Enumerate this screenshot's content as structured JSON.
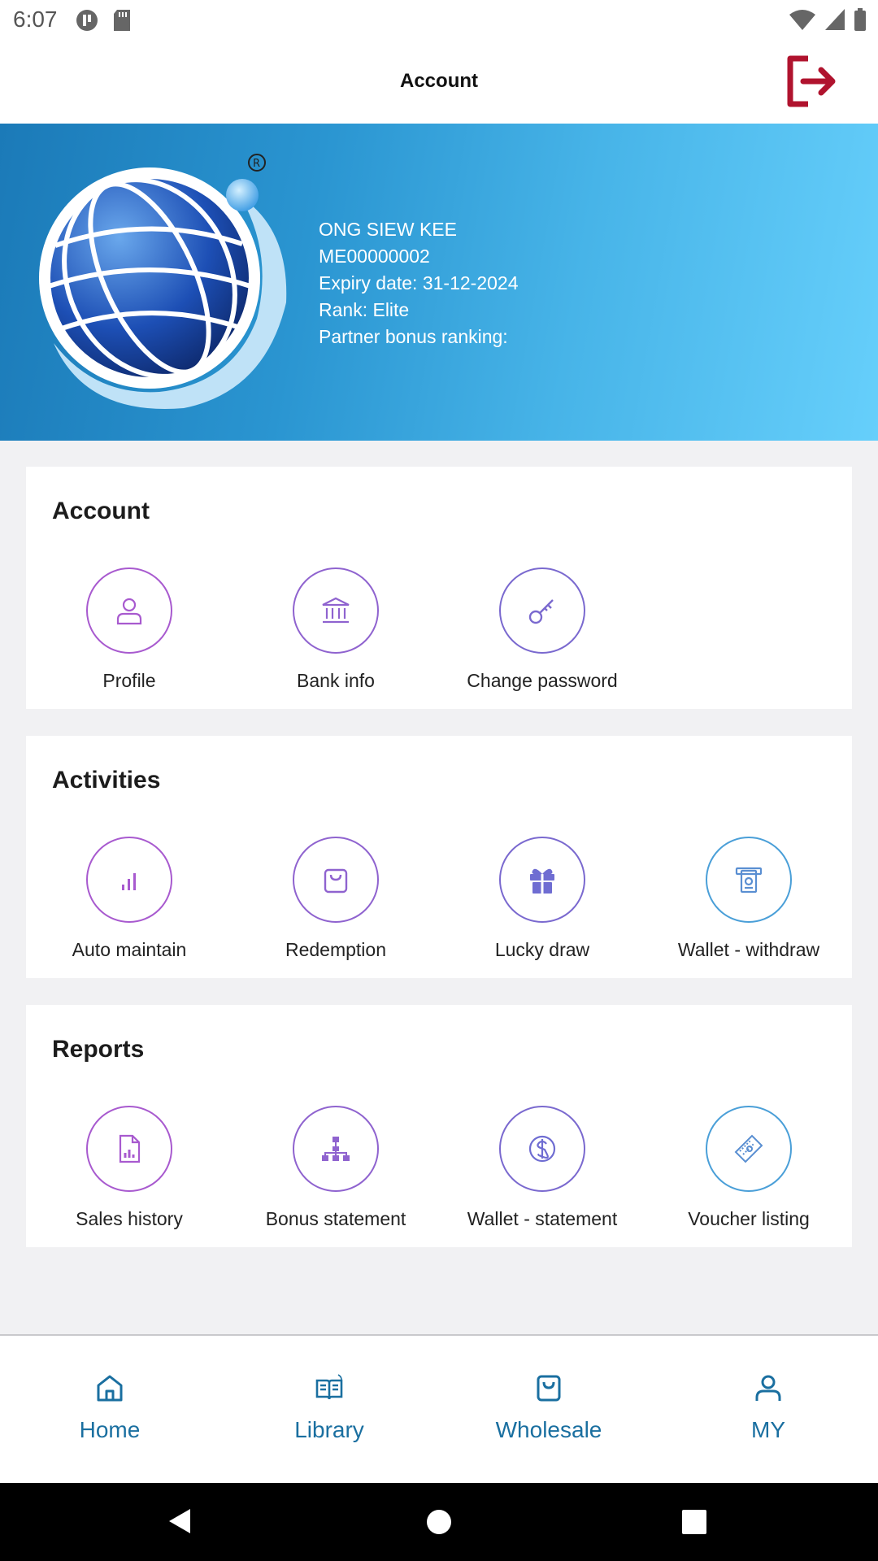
{
  "status_bar": {
    "time": "6:07"
  },
  "header": {
    "title": "Account"
  },
  "member": {
    "name": "ONG SIEW KEE",
    "id": "ME00000002",
    "expiry": "Expiry date: 31-12-2024",
    "rank": "Rank: Elite",
    "partner_bonus": "Partner bonus ranking:"
  },
  "sections": {
    "account": {
      "title": "Account",
      "items": [
        {
          "label": "Profile",
          "icon": "person-icon"
        },
        {
          "label": "Bank info",
          "icon": "bank-icon"
        },
        {
          "label": "Change password",
          "icon": "key-icon"
        }
      ]
    },
    "activities": {
      "title": "Activities",
      "items": [
        {
          "label": "Auto maintain",
          "icon": "bar-chart-icon"
        },
        {
          "label": "Redemption",
          "icon": "shopping-bag-icon"
        },
        {
          "label": "Lucky draw",
          "icon": "gift-icon"
        },
        {
          "label": "Wallet - withdraw",
          "icon": "withdraw-icon"
        }
      ]
    },
    "reports": {
      "title": "Reports",
      "items": [
        {
          "label": "Sales history",
          "icon": "report-icon"
        },
        {
          "label": "Bonus statement",
          "icon": "hierarchy-icon"
        },
        {
          "label": "Wallet - statement",
          "icon": "dollar-icon"
        },
        {
          "label": "Voucher listing",
          "icon": "voucher-icon"
        }
      ]
    }
  },
  "bottom_nav": {
    "home": "Home",
    "library": "Library",
    "wholesale": "Wholesale",
    "my": "MY"
  },
  "colors": {
    "accent_purple": "#9d5fd0",
    "nav_blue": "#1a6fa0",
    "logout_red": "#b0132e",
    "banner_dark": "#1b7ab8",
    "banner_light": "#66cffb"
  }
}
